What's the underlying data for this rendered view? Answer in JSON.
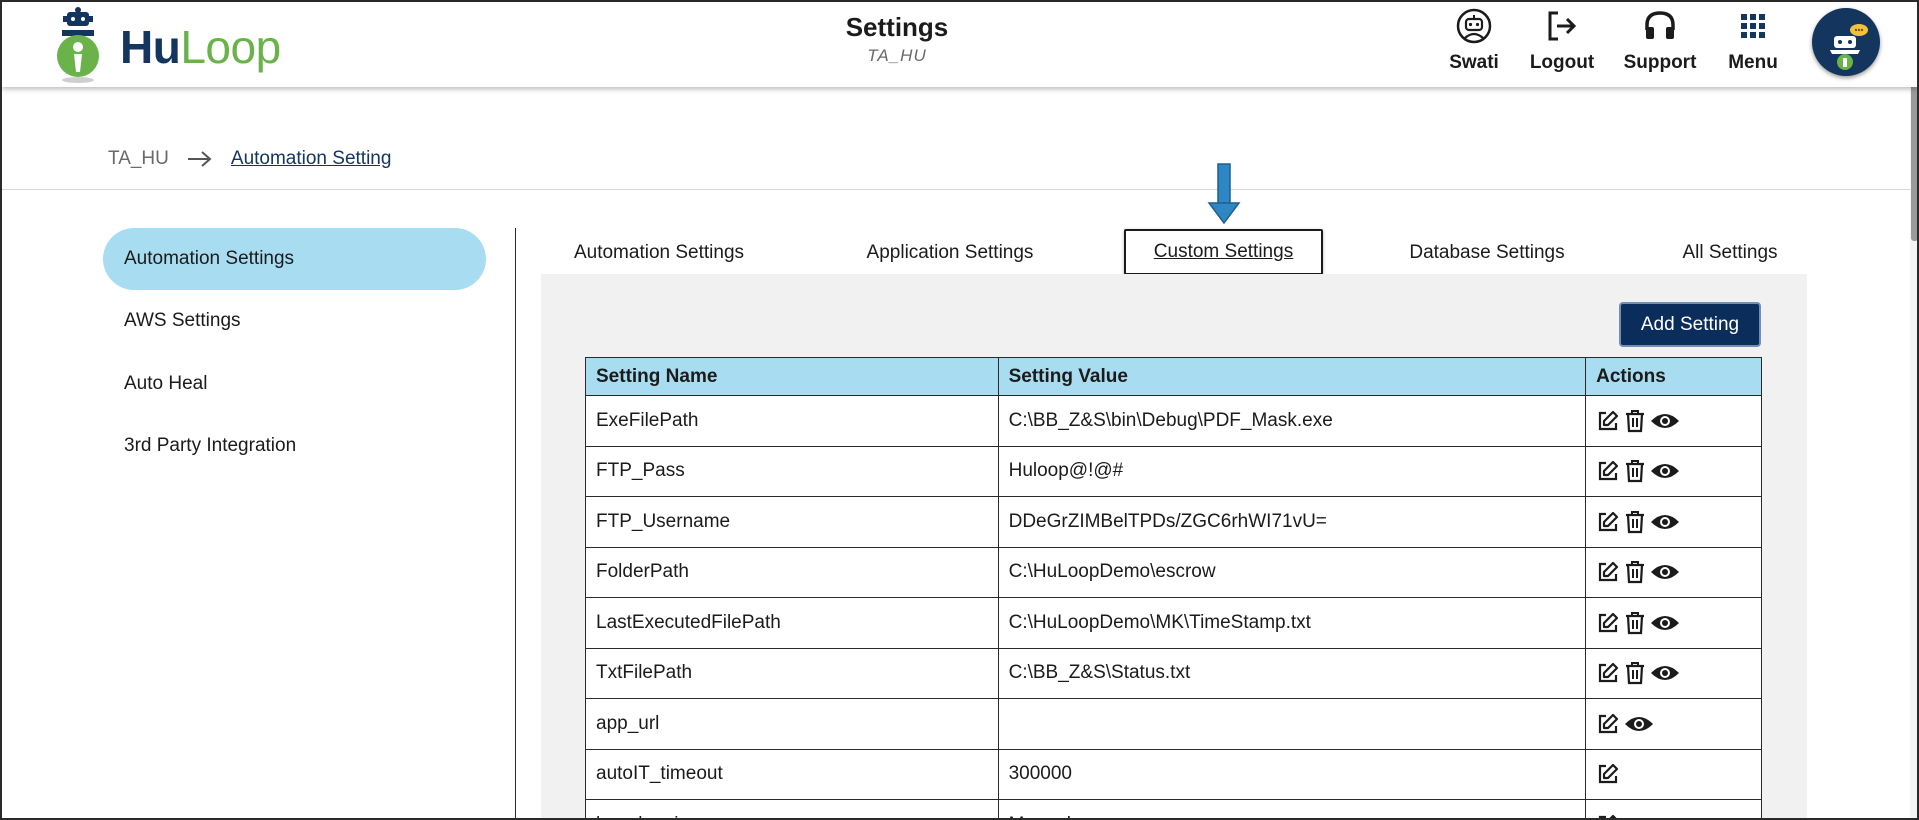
{
  "header": {
    "logo": {
      "part1": "Hu",
      "part2": "Loop"
    },
    "title": "Settings",
    "subtitle": "TA_HU",
    "nav": [
      {
        "label": "Swati",
        "icon": "user-robot-icon"
      },
      {
        "label": "Logout",
        "icon": "logout-icon"
      },
      {
        "label": "Support",
        "icon": "headset-icon"
      },
      {
        "label": "Menu",
        "icon": "grid-menu-icon"
      }
    ],
    "avatar_icon": "bot-avatar-icon"
  },
  "breadcrumb": {
    "root": "TA_HU",
    "current": "Automation Setting"
  },
  "sidebar": {
    "items": [
      {
        "label": "Automation Settings",
        "active": true
      },
      {
        "label": "AWS Settings",
        "active": false
      },
      {
        "label": "Auto Heal",
        "active": false
      },
      {
        "label": "3rd Party Integration",
        "active": false
      }
    ]
  },
  "tabs": [
    {
      "label": "Automation Settings"
    },
    {
      "label": "Application Settings"
    },
    {
      "label": "Custom Settings",
      "selected": true
    },
    {
      "label": "Database Settings"
    },
    {
      "label": "All Settings"
    }
  ],
  "panel": {
    "add_button": "Add Setting",
    "columns": [
      "Setting Name",
      "Setting Value",
      "Actions"
    ],
    "rows": [
      {
        "name": "ExeFilePath",
        "value": "C:\\BB_Z&S\\bin\\Debug\\PDF_Mask.exe",
        "actions": [
          "edit",
          "delete",
          "view"
        ]
      },
      {
        "name": "FTP_Pass",
        "value": "Huloop@!@#",
        "actions": [
          "edit",
          "delete",
          "view"
        ]
      },
      {
        "name": "FTP_Username",
        "value": "DDeGrZIMBelTPDs/ZGC6rhWI71vU=",
        "actions": [
          "edit",
          "delete",
          "view"
        ]
      },
      {
        "name": "FolderPath",
        "value": "C:\\HuLoopDemo\\escrow",
        "actions": [
          "edit",
          "delete",
          "view"
        ]
      },
      {
        "name": "LastExecutedFilePath",
        "value": "C:\\HuLoopDemo\\MK\\TimeStamp.txt",
        "actions": [
          "edit",
          "delete",
          "view"
        ]
      },
      {
        "name": "TxtFilePath",
        "value": "C:\\BB_Z&S\\Status.txt",
        "actions": [
          "edit",
          "delete",
          "view"
        ]
      },
      {
        "name": "app_url",
        "value": "",
        "actions": [
          "edit",
          "view"
        ]
      },
      {
        "name": "autoIT_timeout",
        "value": "300000",
        "actions": [
          "edit"
        ]
      },
      {
        "name": "bug_logging",
        "value": "Manual",
        "actions": [
          "edit"
        ]
      }
    ]
  },
  "colors": {
    "brand_navy": "#13355e",
    "brand_green": "#6ab34a",
    "highlight_blue": "#a8dcf0",
    "button_navy": "#0b2d5c",
    "arrow_blue": "#2f86c4"
  }
}
